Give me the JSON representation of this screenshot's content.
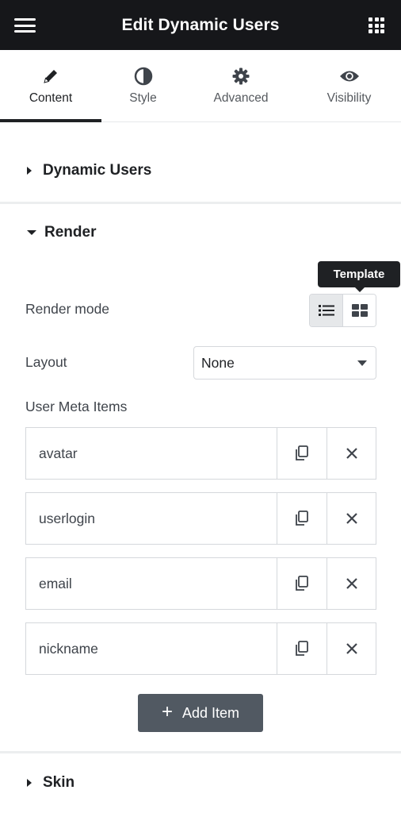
{
  "header": {
    "title": "Edit Dynamic Users"
  },
  "tabs": [
    {
      "label": "Content",
      "icon": "pencil-icon"
    },
    {
      "label": "Style",
      "icon": "half-circle-icon"
    },
    {
      "label": "Advanced",
      "icon": "gear-icon"
    },
    {
      "label": "Visibility",
      "icon": "eye-icon"
    }
  ],
  "sections": {
    "dynamic_users": {
      "title": "Dynamic Users"
    },
    "render": {
      "title": "Render"
    },
    "skin": {
      "title": "Skin"
    }
  },
  "render": {
    "render_mode_label": "Render mode",
    "tooltip": "Template",
    "layout_label": "Layout",
    "layout_value": "None",
    "meta_items_label": "User Meta Items",
    "meta_items": [
      "avatar",
      "userlogin",
      "email",
      "nickname"
    ],
    "add_item_label": "Add Item"
  },
  "colors": {
    "topbar": "#16171a",
    "button": "#515962",
    "text": "#1f2124"
  }
}
